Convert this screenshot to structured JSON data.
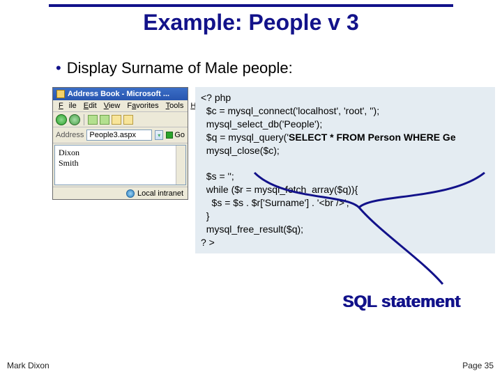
{
  "slide": {
    "title": "Example: People v 3",
    "bullet": "Display Surname of Male people:",
    "footer_left": "Mark Dixon",
    "footer_right": "Page 35",
    "sql_label": "SQL statement"
  },
  "browser": {
    "title": "Address Book - Microsoft ...",
    "menus": {
      "file": "File",
      "edit": "Edit",
      "view": "View",
      "favorites": "Favorites",
      "tools": "Tools",
      "help": "Help"
    },
    "address_label": "Address",
    "address_value": "People3.aspx",
    "go_label": "Go",
    "status": "Local intranet",
    "rows": [
      "Dixon",
      "Smith"
    ]
  },
  "code": {
    "l1": "<? php",
    "l2": "  $c = mysql_connect('localhost', 'root', '');",
    "l3": "  mysql_select_db('People');",
    "l4a": "  $q = mysql_query('",
    "l4b": "SELECT * FROM Person WHERE Ge",
    "l5": "  mysql_close($c);",
    "blank": " ",
    "l6": "  $s = '';",
    "l7": "  while ($r = mysql_fetch_array($q)){",
    "l8": "    $s = $s . $r['Surname'] . '<br />';",
    "l9": "  }",
    "l10": "  mysql_free_result($q);",
    "l11": "? >"
  }
}
